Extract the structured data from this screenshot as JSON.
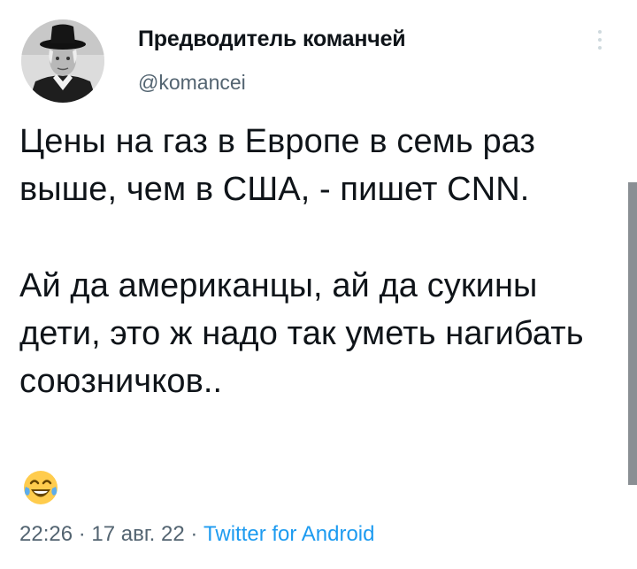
{
  "tweet": {
    "author": {
      "display_name": "Предводитель команчей",
      "handle": "@komancei"
    },
    "text": {
      "paragraph_1": "Цены на газ в Европе в семь раз выше, чем в США, - пишет CNN.",
      "paragraph_2": "Ай да американцы, ай да сукины дети, это ж надо так уметь нагибать союзничков..",
      "emoji_name": "face-with-tears-of-joy-icon"
    },
    "meta": {
      "time": "22:26",
      "separator": " · ",
      "date": "17 авг. 22",
      "source": "Twitter for Android"
    }
  },
  "colors": {
    "text_primary": "#0f1419",
    "text_secondary": "#536471",
    "link": "#1d9bf0",
    "scrollbar": "#8a8f94"
  }
}
